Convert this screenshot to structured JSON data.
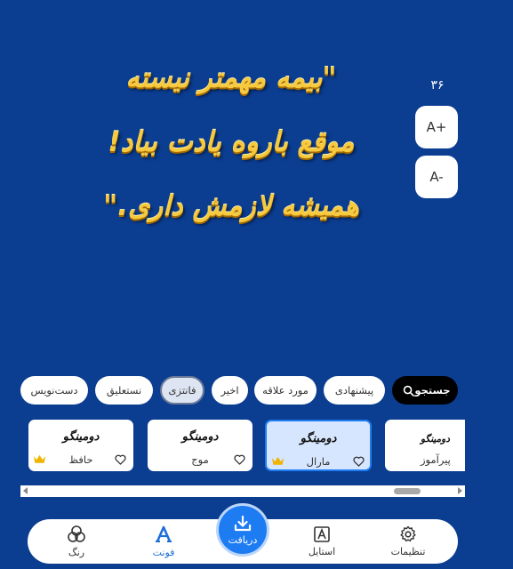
{
  "preview": {
    "lines": [
      "\"بیمه مهمتر نیسته",
      "موقع باروه یادت بیاد!",
      "همیشه لازمش داری.\""
    ],
    "color": "#f6c93f"
  },
  "font_size": {
    "value": "۳۶",
    "increase_label": "A+",
    "decrease_label": "A-"
  },
  "filters": {
    "search_label": "جستجو",
    "chips": [
      "پیشنهادی",
      "مورد علاقه",
      "اخیر",
      "فانتزی",
      "نستعلیق",
      "دست‌نویس"
    ],
    "active": "فانتزی"
  },
  "fonts": [
    {
      "sample": "دومینگو",
      "name": "پیرآموز",
      "favorite_icon": "heart-outline-icon"
    },
    {
      "sample": "دومینگو",
      "name": "مارال",
      "favorite_icon": "heart-outline-icon",
      "premium_icon": "crown-icon",
      "selected": true
    },
    {
      "sample": "دومینگو",
      "name": "موج",
      "favorite_icon": "heart-outline-icon"
    },
    {
      "sample": "دومینگو",
      "name": "حافظ",
      "favorite_icon": "heart-outline-icon",
      "premium_icon": "crown-icon"
    }
  ],
  "nav": {
    "settings": "تنظیمات",
    "style": "استایل",
    "download": "دریافت",
    "font": "فونت",
    "color": "رنگ",
    "active": "فونت"
  },
  "colors": {
    "background": "#0b3d91",
    "accent": "#1e7cf2",
    "crown": "#f0b400"
  }
}
